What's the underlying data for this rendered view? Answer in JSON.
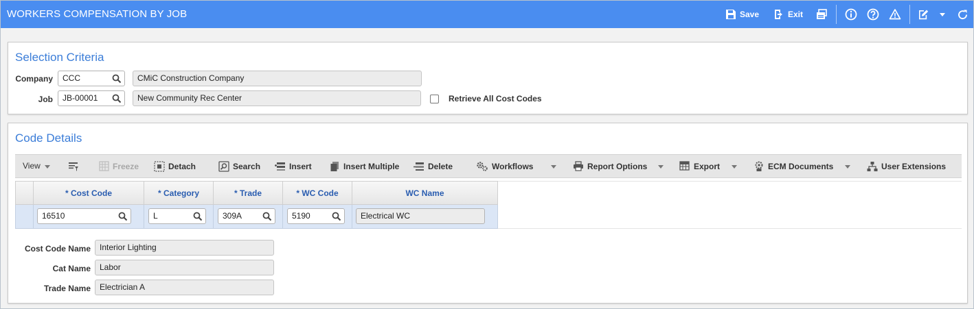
{
  "header": {
    "title": "WORKERS COMPENSATION BY JOB",
    "save_label": "Save",
    "exit_label": "Exit"
  },
  "selection": {
    "title": "Selection Criteria",
    "company_label": "Company",
    "company_code": "CCC",
    "company_name": "CMiC Construction Company",
    "job_label": "Job",
    "job_code": "JB-00001",
    "job_name": "New Community Rec Center",
    "retrieve_label": "Retrieve All Cost Codes",
    "retrieve_checked": false
  },
  "details": {
    "title": "Code Details",
    "toolbar": {
      "view": "View",
      "freeze": "Freeze",
      "detach": "Detach",
      "search": "Search",
      "insert": "Insert",
      "insert_multiple": "Insert Multiple",
      "delete": "Delete",
      "workflows": "Workflows",
      "report_options": "Report Options",
      "export": "Export",
      "ecm_documents": "ECM Documents",
      "user_extensions": "User Extensions"
    },
    "columns": [
      "* Cost Code",
      "* Category",
      "* Trade",
      "* WC Code",
      "WC Name"
    ],
    "rows": [
      [
        "16510",
        "L",
        "309A",
        "5190",
        "Electrical WC"
      ]
    ],
    "cost_code_name_label": "Cost Code Name",
    "cost_code_name": "Interior Lighting",
    "cat_name_label": "Cat Name",
    "cat_name": "Labor",
    "trade_name_label": "Trade Name",
    "trade_name": "Electrician A"
  },
  "colors": {
    "header_bg": "#4a8df0",
    "panel_title": "#3b7dd8",
    "grid_header_text": "#2a5db0",
    "selected_row": "#dbe6f6"
  }
}
